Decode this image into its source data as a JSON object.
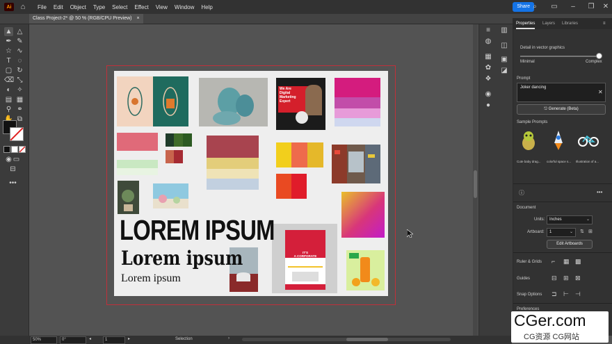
{
  "app": {
    "logo_text": "Ai"
  },
  "menus": [
    "File",
    "Edit",
    "Object",
    "Type",
    "Select",
    "Effect",
    "View",
    "Window",
    "Help"
  ],
  "toolbar_right": {
    "share_label": "Share"
  },
  "document_tab": {
    "title": "Class Project-2* @ 50 % (RGB/CPU Preview)",
    "close": "×"
  },
  "artboard": {
    "big_title": "LOREM IPSUM",
    "mid_title": "Lorem ipsum",
    "small_title": "Lorem ipsum",
    "flyer1": {
      "line1": "We Are",
      "line2": "Digital",
      "line3": "Marketing",
      "line4": "Expert"
    },
    "flyer2": {
      "line1": "IT'S",
      "line2": "A CORPORATE",
      "line3": "FLYER"
    }
  },
  "panel": {
    "tabs": [
      "Properties",
      "Layers",
      "Libraries"
    ],
    "detail_label": "Detail in vector graphics",
    "slider_min": "Minimal",
    "slider_max": "Complex",
    "prompt_label": "Prompt",
    "prompt_value": "Joker dancing",
    "generate_label": "Generate (Beta)",
    "samples_label": "Sample Prompts",
    "samples": [
      "Cute baby drag...",
      "colorful space s...",
      "Illustration of a..."
    ],
    "document_label": "Document",
    "units_label": "Units:",
    "units_value": "Inches",
    "artboard_label": "Artboard:",
    "artboard_value": "1",
    "edit_artboards": "Edit Artboards",
    "ruler_grids": "Ruler & Grids",
    "guides": "Guides",
    "snap_options": "Snap Options",
    "preferences": "Preferences"
  },
  "status": {
    "zoom": "50%",
    "rotate": "0°",
    "artboard_num": "1",
    "tool": "Selection"
  },
  "watermark": {
    "line1": "CGer.com",
    "line2": "CG资源 CG网站"
  },
  "colors": {
    "accent": "#1473e6",
    "artboard_border": "#c0303a"
  }
}
